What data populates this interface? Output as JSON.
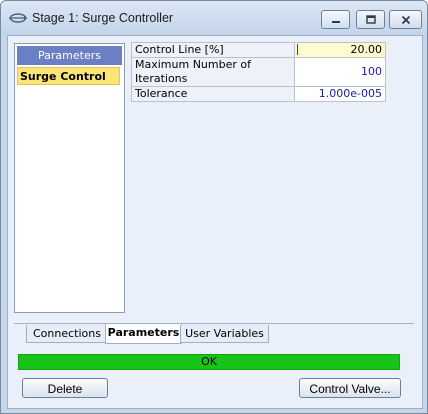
{
  "window": {
    "title": "Stage 1: Surge Controller",
    "controls": {
      "minimize": "minimize-icon",
      "maximize": "maximize-icon",
      "close": "close-icon"
    }
  },
  "left_panel": {
    "header": "Parameters",
    "items": [
      {
        "label": "Surge Control",
        "selected": true
      }
    ]
  },
  "parameters": [
    {
      "name": "Control Line [%]",
      "value": "20.00"
    },
    {
      "name": "Maximum Number of Iterations",
      "value": "100"
    },
    {
      "name": "Tolerance",
      "value": "1.000e-005"
    }
  ],
  "tabs": [
    {
      "label": "Connections",
      "active": false
    },
    {
      "label": "Parameters",
      "active": true
    },
    {
      "label": "User Variables",
      "active": false
    }
  ],
  "status": {
    "text": "OK",
    "color": "#18c418"
  },
  "buttons": {
    "delete": "Delete",
    "control_valve": "Control Valve..."
  }
}
